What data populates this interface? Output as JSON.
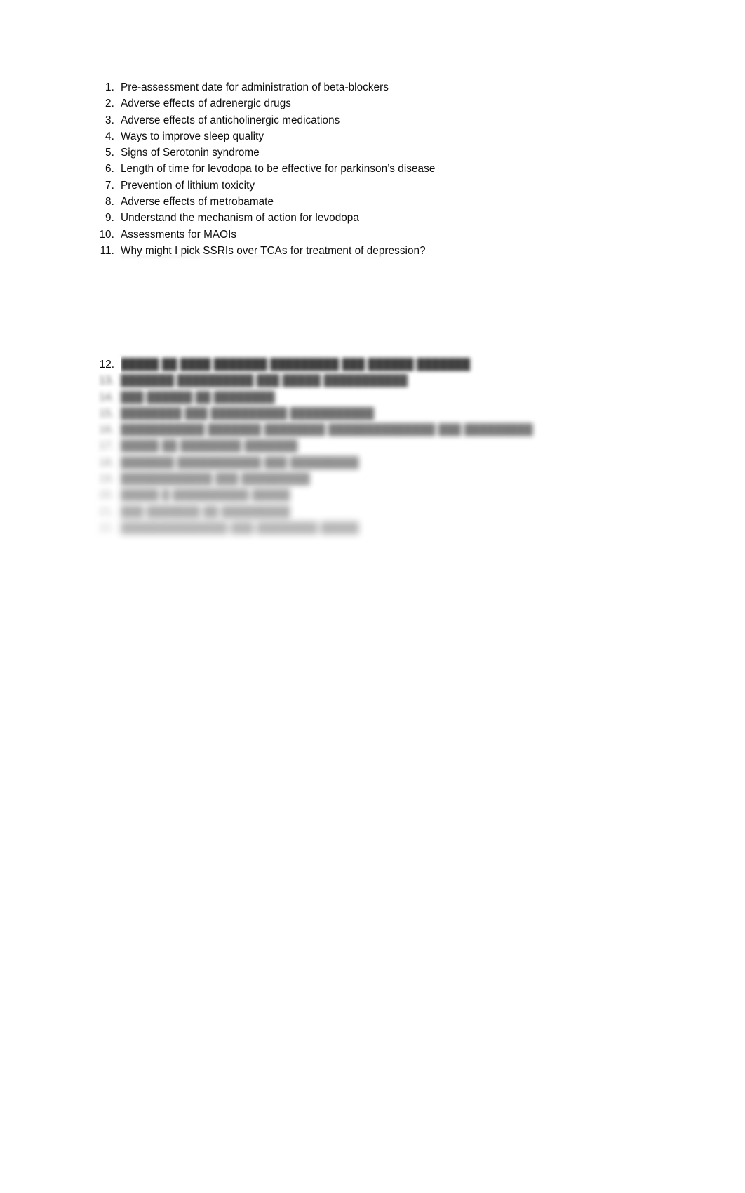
{
  "document": {
    "background_color": "#ffffff",
    "text_color": "#0d0d0d",
    "list_marker_suffix": "."
  },
  "legible_list": {
    "items": [
      {
        "number": "1.",
        "text": "Pre-assessment date for administration of beta-blockers"
      },
      {
        "number": "2.",
        "text": "Adverse effects of adrenergic drugs"
      },
      {
        "number": "3.",
        "text": "Adverse effects of anticholinergic medications"
      },
      {
        "number": "4.",
        "text": "Ways to improve sleep quality"
      },
      {
        "number": "5.",
        "text": "Signs of Serotonin syndrome"
      },
      {
        "number": "6.",
        "text": "Length of time for levodopa to be effective for parkinson’s disease"
      },
      {
        "number": "7.",
        "text": "Prevention of lithium toxicity"
      },
      {
        "number": "8.",
        "text": "Adverse effects of metrobamate"
      },
      {
        "number": "9.",
        "text": "Understand the mechanism of action for levodopa"
      },
      {
        "number": "10.",
        "text": "Assessments for MAOIs"
      },
      {
        "number": "11.",
        "text": "Why might I pick SSRIs over TCAs for treatment of depression?"
      }
    ]
  },
  "redacted_list": {
    "note": "illegible",
    "visible_marker": "12.",
    "items": [
      {
        "number": "12.",
        "text": "█████ ██ ████ ███████ █████████ ███ ██████ ███████"
      },
      {
        "number": "13.",
        "text": "███████ ██████████ ███ █████ ███████████"
      },
      {
        "number": "14.",
        "text": "███ ██████ ██ ████████"
      },
      {
        "number": "15.",
        "text": "████████ ███ ██████████ ███████████"
      },
      {
        "number": "16.",
        "text": "███████████ ███████ ████████ ██████████████ ███ █████████"
      },
      {
        "number": "17.",
        "text": "█████ ██ ████████ ███████"
      },
      {
        "number": "18.",
        "text": "███████ ███████████ ███ █████████"
      },
      {
        "number": "19.",
        "text": "████████████ ███ █████████"
      },
      {
        "number": "20.",
        "text": "█████ █ ██████████ █████"
      },
      {
        "number": "21.",
        "text": "███ ███████ ██ █████████"
      },
      {
        "number": "22.",
        "text": "██████████████ ███ ████████ █████"
      }
    ]
  }
}
